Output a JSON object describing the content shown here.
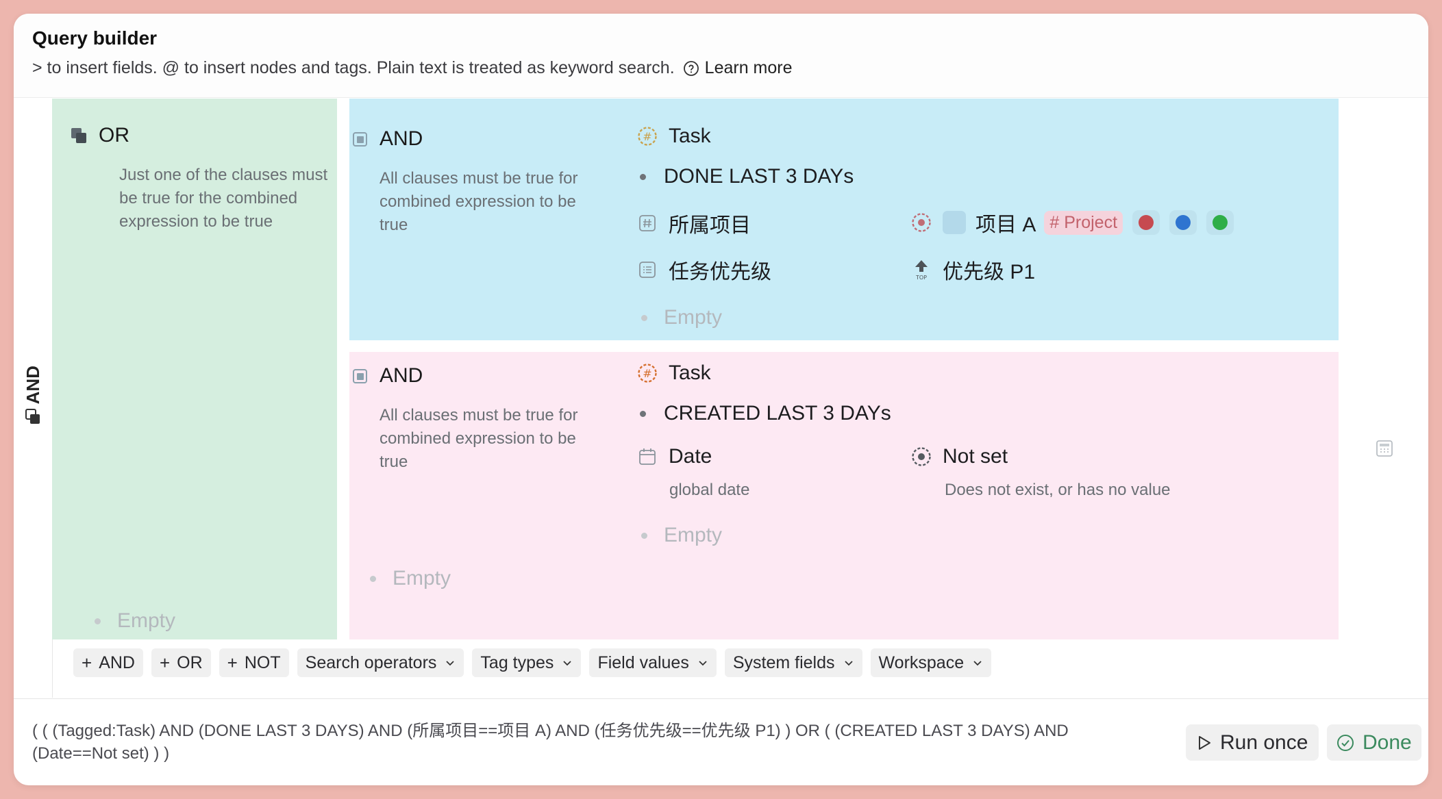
{
  "header": {
    "title": "Query builder",
    "hint": "> to insert fields. @ to insert nodes and tags. Plain text is treated as keyword search.",
    "learn_more": "Learn more"
  },
  "root": {
    "operator": "AND"
  },
  "or_group": {
    "operator": "OR",
    "description": "Just one of the clauses must be true for the combined expression to be true",
    "empty": "Empty"
  },
  "and_group_1": {
    "operator": "AND",
    "description": "All clauses must be true for combined expression to be true",
    "tag": "Task",
    "search": "DONE LAST 3 DAYs",
    "field1": {
      "name": "所属项目",
      "value": "项目 A",
      "tag": "# Project"
    },
    "color_chips": [
      "#c64a50",
      "#2f74d0",
      "#2eae48"
    ],
    "field2": {
      "name": "任务优先级",
      "value": "优先级 P1"
    },
    "empty": "Empty"
  },
  "and_group_2": {
    "operator": "AND",
    "description": "All clauses must be true for combined expression to be true",
    "tag": "Task",
    "search": "CREATED LAST 3 DAYs",
    "field": {
      "name": "Date",
      "sub": "global date",
      "value": "Not set",
      "value_sub": "Does not exist, or has no value"
    },
    "inner_empty": "Empty",
    "outer_empty": "Empty"
  },
  "toolbar": {
    "add_and": "AND",
    "add_or": "OR",
    "add_not": "NOT",
    "search_operators": "Search operators",
    "tag_types": "Tag types",
    "field_values": "Field values",
    "system_fields": "System fields",
    "workspace": "Workspace"
  },
  "footer": {
    "expression": "( ( (Tagged:Task) AND (DONE LAST 3 DAYS) AND (所属项目==项目 A) AND (任务优先级==优先级 P1) ) OR ( (CREATED LAST 3 DAYS) AND (Date==Not set) ) )",
    "run_once": "Run once",
    "done": "Done"
  },
  "colors": {
    "background": "#edb6ae",
    "or_panel": "#d5eedf",
    "and_panel_1": "#c8ecf7",
    "and_panel_2": "#fde9f3",
    "done_green": "#3b8a5e"
  }
}
